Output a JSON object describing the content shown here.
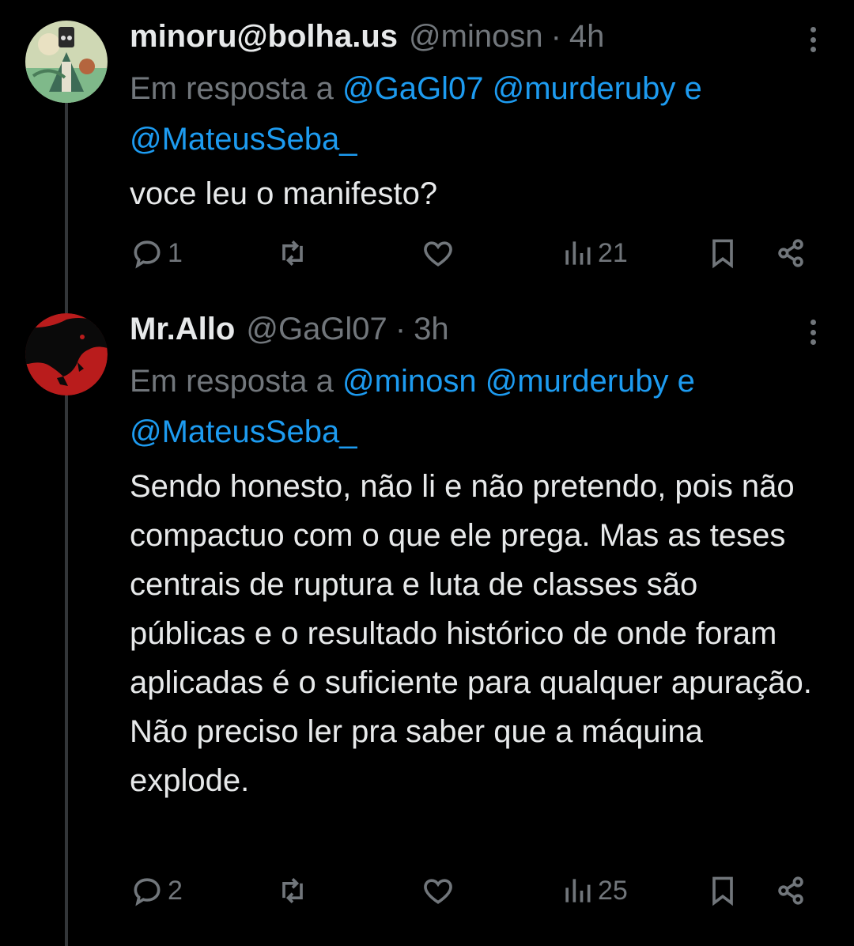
{
  "tweets": [
    {
      "display_name": "minoru@bolha.us",
      "handle": "@minosn",
      "separator": "·",
      "time": "4h",
      "reply_prefix": "Em resposta a",
      "mention_1": "@GaGl07",
      "mention_2": "@murderuby",
      "conjunction": "e",
      "mention_3": "@MateusSeba_",
      "text": "voce leu o manifesto?",
      "replies": "1",
      "views": "21"
    },
    {
      "display_name": "Mr.Allo",
      "handle": "@GaGl07",
      "separator": "·",
      "time": "3h",
      "reply_prefix": "Em resposta a",
      "mention_1": "@minosn",
      "mention_2": "@murderuby",
      "conjunction": "e",
      "mention_3": "@MateusSeba_",
      "text": "Sendo honesto, não li e não pretendo, pois não compactuo com o que ele prega. Mas as teses centrais de ruptura e luta de classes são públicas e o resultado histórico de onde foram aplicadas é o suficiente para qualquer apuração. Não preciso ler pra saber que a máquina explode.",
      "replies": "2",
      "views": "25"
    }
  ],
  "icons": {
    "reply": "reply-icon",
    "retweet": "retweet-icon",
    "like": "heart-icon",
    "views": "views-icon",
    "bookmark": "bookmark-icon",
    "share": "share-icon",
    "more": "more-icon"
  },
  "colors": {
    "background": "#000000",
    "text": "#e7e9ea",
    "muted": "#71767b",
    "link": "#1d9bf0",
    "thread_line": "#333639"
  }
}
